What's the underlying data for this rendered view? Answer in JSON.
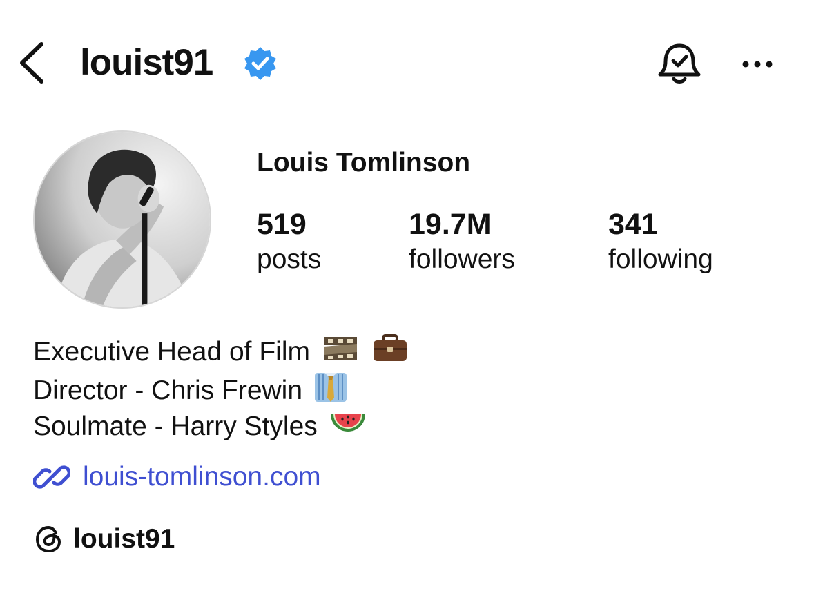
{
  "header": {
    "username": "louist91",
    "verified_color": "#3897f0",
    "icons": [
      "back-arrow-icon",
      "verified-badge-icon",
      "bell-check-icon",
      "more-options-icon"
    ]
  },
  "profile": {
    "full_name": "Louis Tomlinson",
    "stats": {
      "posts": {
        "value": "519",
        "label": "posts"
      },
      "followers": {
        "value": "19.7M",
        "label": "followers"
      },
      "following": {
        "value": "341",
        "label": "following"
      }
    },
    "bio": [
      {
        "text": "Executive Head of Film",
        "emoji": [
          "film-strip-emoji",
          "briefcase-emoji"
        ]
      },
      {
        "text": "Director - Chris Frewin",
        "emoji": [
          "necktie-shirt-emoji"
        ]
      },
      {
        "text": "Soulmate - Harry Styles",
        "emoji": [
          "watermelon-emoji"
        ]
      }
    ],
    "link": {
      "text": "louis-tomlinson.com",
      "color": "#3f4fd1",
      "icon": "link-chain-icon"
    },
    "threads": {
      "handle": "louist91",
      "icon": "threads-icon"
    }
  }
}
